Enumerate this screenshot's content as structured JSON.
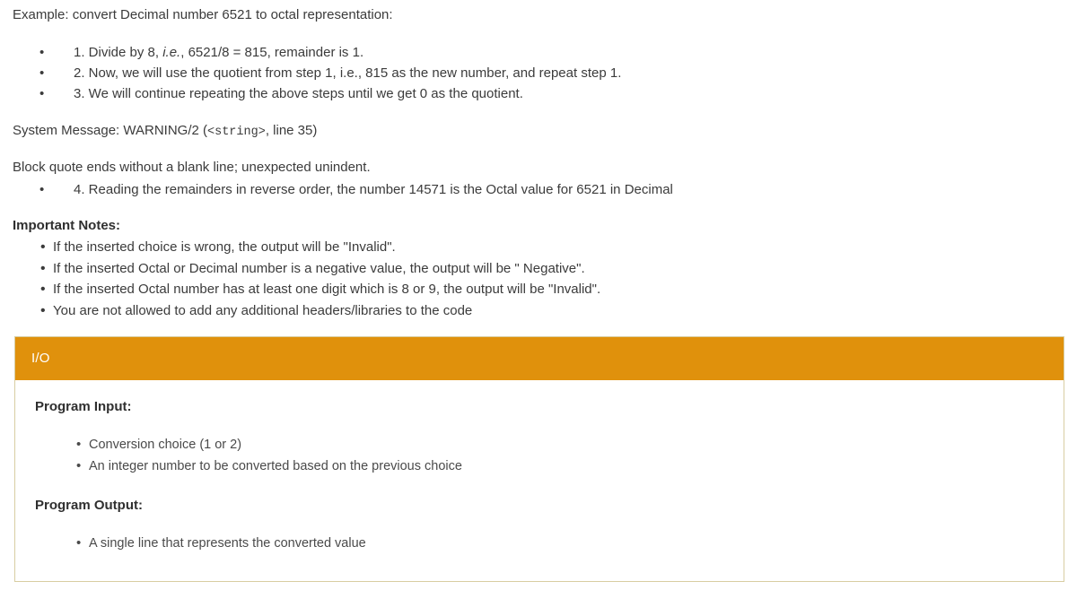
{
  "example": {
    "intro": "Example: convert Decimal number 6521 to octal representation:",
    "steps": [
      {
        "bullet": "•",
        "pre": "1. Divide by 8, ",
        "em": "i.e.",
        "post": ", 6521/8 = 815, remainder is 1."
      },
      {
        "bullet": "•",
        "pre": "2. Now, we will use the quotient from step 1, i.e., 815 as the new number, and repeat step 1.",
        "em": "",
        "post": ""
      },
      {
        "bullet": "•",
        "pre": "3. We will continue repeating the above steps until we get 0 as the quotient.",
        "em": "",
        "post": ""
      }
    ]
  },
  "system_message": {
    "prefix": "System Message: WARNING/2 (",
    "mono": "<string>",
    "suffix": ", line 35)",
    "detail": "Block quote ends without a blank line; unexpected unindent.",
    "trailing_step": {
      "bullet": "•",
      "text": "4. Reading the remainders in reverse order, the number 14571 is the Octal value for 6521 in Decimal"
    }
  },
  "important_notes": {
    "heading": "Important Notes:",
    "items": [
      {
        "bullet": "•",
        "text": "If the inserted choice is wrong, the output will be \"Invalid\"."
      },
      {
        "bullet": "•",
        "text": "If the inserted Octal or Decimal number is a negative value, the output will be \" Negative\"."
      },
      {
        "bullet": "•",
        "text": "If the inserted Octal number has at least one digit which is 8 or 9, the output will be \"Invalid\"."
      },
      {
        "bullet": "•",
        "text": "You are not allowed to add any additional headers/libraries to the code"
      }
    ]
  },
  "io_panel": {
    "title": "I/O",
    "header_color": "#e0910c",
    "border_color": "#d8cda2",
    "input_heading": "Program Input:",
    "input_items": [
      {
        "bullet": "•",
        "text": "Conversion choice (1 or 2)"
      },
      {
        "bullet": "•",
        "text": "An integer number to be converted based on the previous choice"
      }
    ],
    "output_heading": "Program Output:",
    "output_items": [
      {
        "bullet": "•",
        "text": "A single line that represents the converted value"
      }
    ]
  }
}
